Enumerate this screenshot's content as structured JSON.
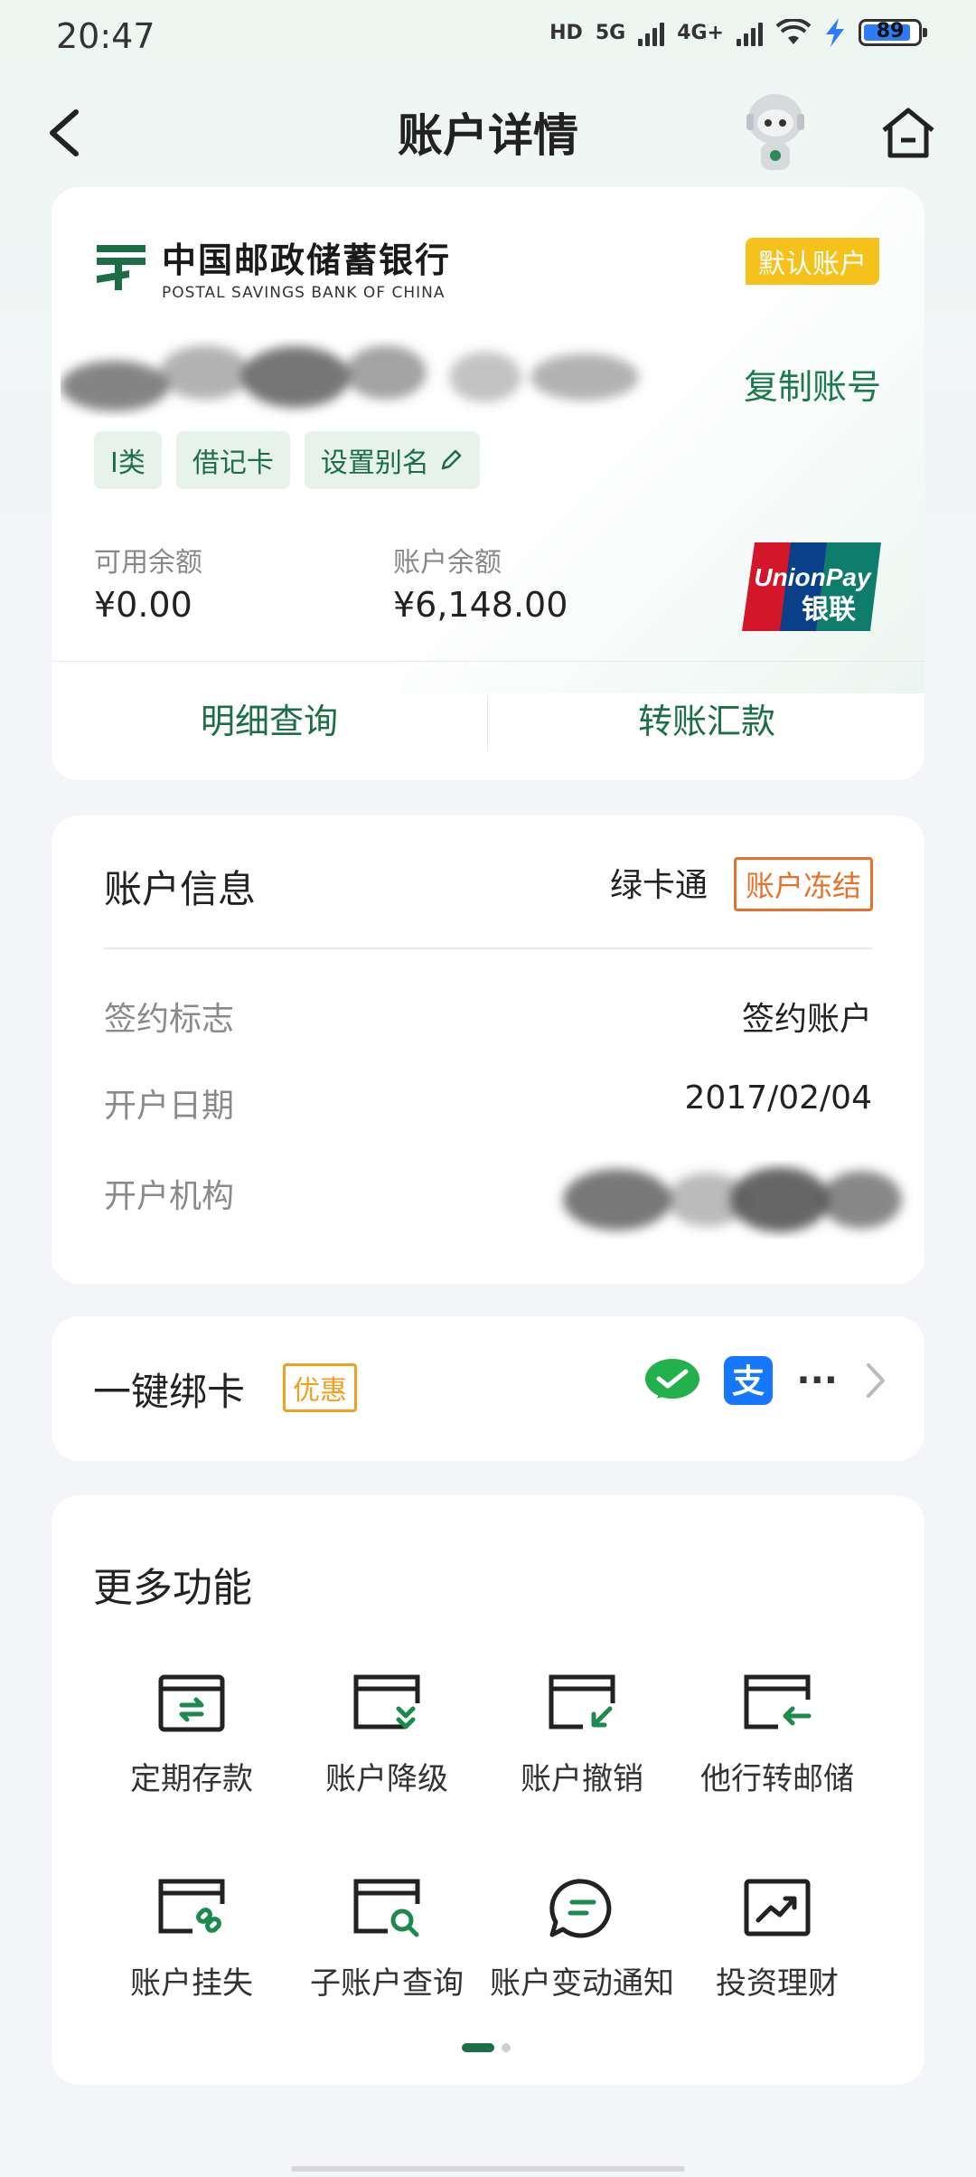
{
  "status_bar": {
    "time": "20:47",
    "network1": "HD",
    "network2": "5G",
    "network3": "4G+",
    "battery": "89"
  },
  "header": {
    "title": "账户详情",
    "back_icon": "chevron-left-icon",
    "home_icon": "home-icon"
  },
  "account_card": {
    "bank_name_cn": "中国邮政储蓄银行",
    "bank_name_en": "POSTAL SAVINGS BANK OF CHINA",
    "default_badge": "默认账户",
    "copy_label": "复制账号",
    "tags": [
      "I类",
      "借记卡",
      "设置别名"
    ],
    "available_label": "可用余额",
    "available_value": "¥0.00",
    "balance_label": "账户余额",
    "balance_value": "¥6,148.00",
    "unionpay_en": "UnionPay",
    "unionpay_cn": "银联",
    "action_detail": "明细查询",
    "action_transfer": "转账汇款"
  },
  "account_info": {
    "title": "账户信息",
    "green_card": "绿卡通",
    "frozen_badge": "账户冻结",
    "rows": [
      {
        "label": "签约标志",
        "value": "签约账户"
      },
      {
        "label": "开户日期",
        "value": "2017/02/04"
      },
      {
        "label": "开户机构",
        "value": ""
      }
    ]
  },
  "bind_card": {
    "title": "一键绑卡",
    "promo": "优惠",
    "more": "···",
    "icons": [
      "wechat-icon",
      "alipay-icon"
    ]
  },
  "more_functions": {
    "title": "更多功能",
    "items": [
      {
        "label": "定期存款",
        "icon": "fixed-deposit-icon"
      },
      {
        "label": "账户降级",
        "icon": "account-downgrade-icon"
      },
      {
        "label": "账户撤销",
        "icon": "account-cancel-icon"
      },
      {
        "label": "他行转邮储",
        "icon": "transfer-in-icon"
      },
      {
        "label": "账户挂失",
        "icon": "report-loss-icon"
      },
      {
        "label": "子账户查询",
        "icon": "sub-account-search-icon"
      },
      {
        "label": "账户变动通知",
        "icon": "notification-icon"
      },
      {
        "label": "投资理财",
        "icon": "investment-icon"
      }
    ],
    "page_indicator": {
      "current": 1,
      "total": 2
    }
  },
  "colors": {
    "brand_green": "#1b6e46",
    "badge_yellow": "#f5c21b",
    "frozen_orange": "#e8702a",
    "promo_orange": "#f0a020"
  }
}
